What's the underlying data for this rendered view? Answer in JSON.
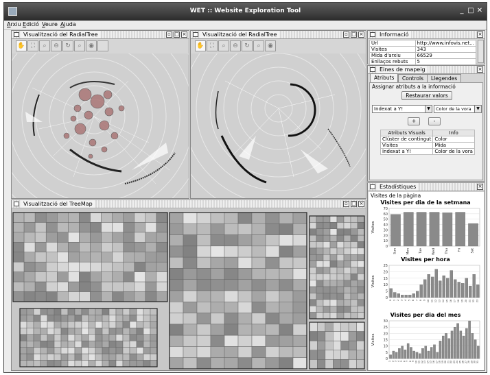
{
  "window": {
    "title": "WET :: Website Exploration Tool"
  },
  "menu": [
    "Arxiu",
    "Edició",
    "Veure",
    "Ajuda"
  ],
  "colors": {
    "accent": "#3a3a3a",
    "bar_series": "#8a8a8a"
  },
  "radial1": {
    "title": "Visualització del RadialTree"
  },
  "radial2": {
    "title": "Visualització del RadialTree"
  },
  "treemap": {
    "title": "Visualització del TreeMap"
  },
  "toolbar_icons": [
    "hand-icon",
    "fit-icon",
    "zoom-icon",
    "zoom-out-icon",
    "rotate-icon",
    "search-icon",
    "eye-icon"
  ],
  "info": {
    "title": "Informació",
    "rows": [
      {
        "k": "Url",
        "v": "http://www.infovis.net..."
      },
      {
        "k": "Visites",
        "v": "343"
      },
      {
        "k": "Mida d'arxiu",
        "v": "66529"
      },
      {
        "k": "Enllaços rebuts",
        "v": "5"
      }
    ]
  },
  "mapping": {
    "title": "Eines de mapeig",
    "tabs": [
      "Atributs",
      "Controls",
      "Llegendes"
    ],
    "section": "Assignar atributs a la informació",
    "reset": "Restaurar valors",
    "combo_left": "Indexat a Y!",
    "combo_right": "Color de la vora",
    "plus": "+",
    "minus": "-",
    "headers": [
      "Atributs Visuals",
      "Info"
    ],
    "rows": [
      {
        "k": "Clúster de contingut",
        "v": "Color"
      },
      {
        "k": "Visites",
        "v": "Mida"
      },
      {
        "k": "Indexat a Y!",
        "v": "Color de la vora"
      }
    ]
  },
  "stats": {
    "title": "Estadístiques",
    "subtitle": "Visites de la pàgina"
  },
  "chart_data": [
    {
      "type": "bar",
      "title": "Visites per dia de la setmana",
      "ylabel": "Visites",
      "categories": [
        "Sun",
        "Mon",
        "Tue",
        "Wed",
        "Thu",
        "Fri",
        "Sat"
      ],
      "values": [
        59,
        63,
        63,
        63,
        62,
        63,
        42
      ],
      "ylim": [
        0,
        70
      ],
      "yticks": [
        0,
        10,
        20,
        30,
        40,
        50,
        60,
        70
      ]
    },
    {
      "type": "bar",
      "title": "Visites per hora",
      "ylabel": "Visites",
      "categories": [
        "0",
        "1",
        "2",
        "3",
        "4",
        "5",
        "6",
        "7",
        "8",
        "9",
        "10",
        "11",
        "12",
        "13",
        "14",
        "15",
        "16",
        "17",
        "18",
        "19",
        "20",
        "21",
        "22",
        "23"
      ],
      "values": [
        7,
        4,
        3,
        2,
        2,
        2,
        3,
        5,
        10,
        14,
        18,
        16,
        22,
        13,
        17,
        15,
        21,
        14,
        12,
        11,
        15,
        9,
        18,
        10
      ],
      "ylim": [
        0,
        25
      ],
      "yticks": [
        0,
        5,
        10,
        15,
        20,
        25
      ]
    },
    {
      "type": "bar",
      "title": "Visites per dia del mes",
      "ylabel": "Visites",
      "categories": [
        "1",
        "2",
        "3",
        "4",
        "5",
        "6",
        "7",
        "8",
        "9",
        "10",
        "11",
        "12",
        "13",
        "14",
        "15",
        "16",
        "17",
        "18",
        "19",
        "20",
        "21",
        "22",
        "23",
        "24",
        "25",
        "26",
        "27",
        "28",
        "29",
        "30",
        "31"
      ],
      "values": [
        3,
        6,
        5,
        8,
        10,
        7,
        12,
        9,
        6,
        5,
        4,
        8,
        10,
        6,
        9,
        11,
        5,
        14,
        18,
        20,
        16,
        22,
        25,
        28,
        22,
        18,
        24,
        30,
        20,
        15,
        10
      ],
      "ylim": [
        0,
        30
      ],
      "yticks": [
        0,
        5,
        10,
        15,
        20,
        25,
        30
      ]
    }
  ]
}
